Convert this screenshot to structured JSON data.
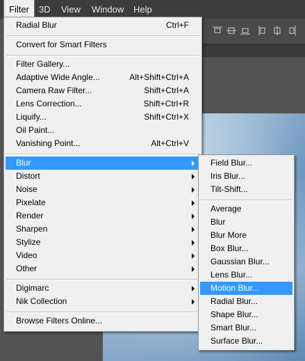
{
  "menubar": {
    "items": [
      {
        "label": "Filter",
        "active": true
      },
      {
        "label": "3D"
      },
      {
        "label": "View"
      },
      {
        "label": "Window"
      },
      {
        "label": "Help"
      }
    ]
  },
  "filter_menu": {
    "items": [
      {
        "label": "Radial Blur",
        "shortcut": "Ctrl+F"
      },
      {
        "label": "Convert for Smart Filters"
      },
      {
        "label": "Filter Gallery..."
      },
      {
        "label": "Adaptive Wide Angle...",
        "shortcut": "Alt+Shift+Ctrl+A"
      },
      {
        "label": "Camera Raw Filter...",
        "shortcut": "Shift+Ctrl+A"
      },
      {
        "label": "Lens Correction...",
        "shortcut": "Shift+Ctrl+R"
      },
      {
        "label": "Liquify...",
        "shortcut": "Shift+Ctrl+X"
      },
      {
        "label": "Oil Paint..."
      },
      {
        "label": "Vanishing Point...",
        "shortcut": "Alt+Ctrl+V"
      },
      {
        "label": "Blur",
        "submenu": true,
        "highlighted": true
      },
      {
        "label": "Distort",
        "submenu": true
      },
      {
        "label": "Noise",
        "submenu": true
      },
      {
        "label": "Pixelate",
        "submenu": true
      },
      {
        "label": "Render",
        "submenu": true
      },
      {
        "label": "Sharpen",
        "submenu": true
      },
      {
        "label": "Stylize",
        "submenu": true
      },
      {
        "label": "Video",
        "submenu": true
      },
      {
        "label": "Other",
        "submenu": true
      },
      {
        "label": "Digimarc",
        "submenu": true
      },
      {
        "label": "Nik Collection",
        "submenu": true
      },
      {
        "label": "Browse Filters Online..."
      }
    ]
  },
  "blur_submenu": {
    "items": [
      {
        "label": "Field Blur..."
      },
      {
        "label": "Iris Blur..."
      },
      {
        "label": "Tilt-Shift..."
      },
      {
        "label": "Average"
      },
      {
        "label": "Blur"
      },
      {
        "label": "Blur More"
      },
      {
        "label": "Box Blur..."
      },
      {
        "label": "Gaussian Blur..."
      },
      {
        "label": "Lens Blur..."
      },
      {
        "label": "Motion Blur...",
        "highlighted": true
      },
      {
        "label": "Radial Blur..."
      },
      {
        "label": "Shape Blur..."
      },
      {
        "label": "Smart Blur..."
      },
      {
        "label": "Surface Blur..."
      }
    ]
  },
  "options_bar": {
    "icons": [
      "align-top-edges-icon",
      "align-vertical-centers-icon",
      "align-bottom-edges-icon",
      "distribute-left-edges-icon",
      "distribute-horizontal-centers-icon",
      "distribute-right-edges-icon"
    ]
  },
  "colors": {
    "menu_bg": "#f0f0f0",
    "highlight": "#3399ff",
    "menubar_bg": "#3c3c3c",
    "workspace_bg": "#535353"
  }
}
